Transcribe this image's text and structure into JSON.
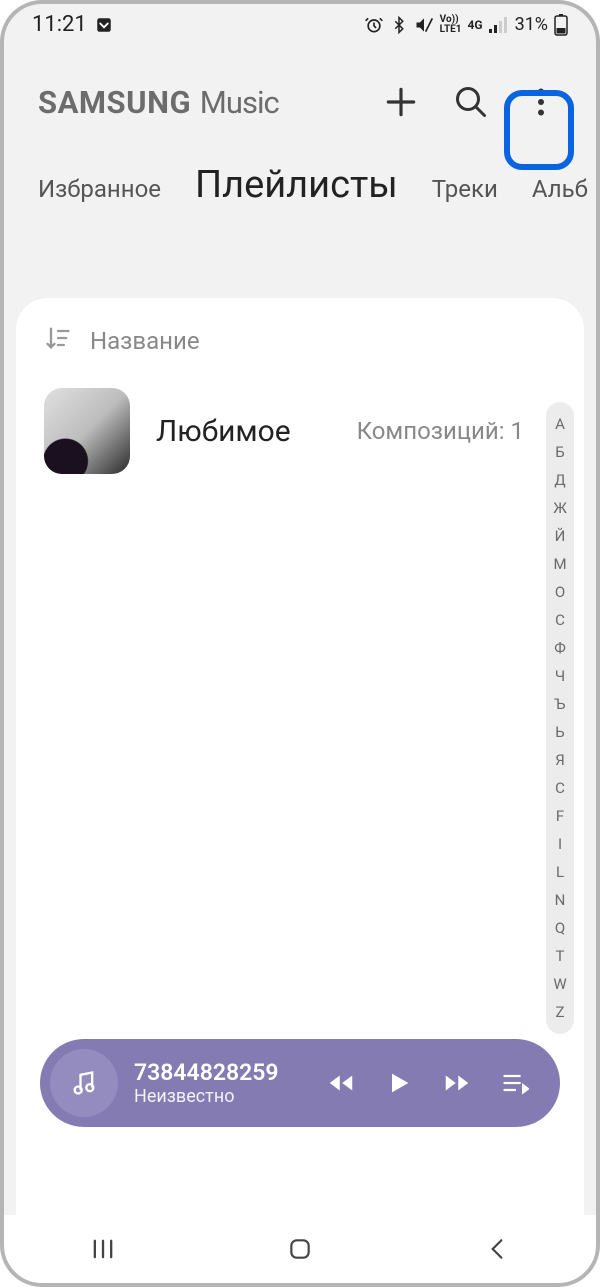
{
  "status": {
    "time": "11:21",
    "battery_text": "31%"
  },
  "header": {
    "title_bold": "SAMSUNG",
    "title_light": "Music"
  },
  "tabs": [
    {
      "label": "Избранное",
      "active": false
    },
    {
      "label": "Плейлисты",
      "active": true
    },
    {
      "label": "Треки",
      "active": false
    },
    {
      "label": "Альб",
      "active": false
    }
  ],
  "sort": {
    "label": "Название"
  },
  "playlists": [
    {
      "title": "Любимое",
      "meta": "Композиций: 1"
    }
  ],
  "index_letters": [
    "А",
    "Б",
    "Д",
    "Ж",
    "Й",
    "М",
    "О",
    "С",
    "Ф",
    "Ч",
    "Ъ",
    "Ь",
    "Я",
    "C",
    "F",
    "I",
    "L",
    "N",
    "Q",
    "T",
    "W",
    "Z"
  ],
  "player": {
    "title": "73844828259",
    "artist": "Неизвестно"
  }
}
